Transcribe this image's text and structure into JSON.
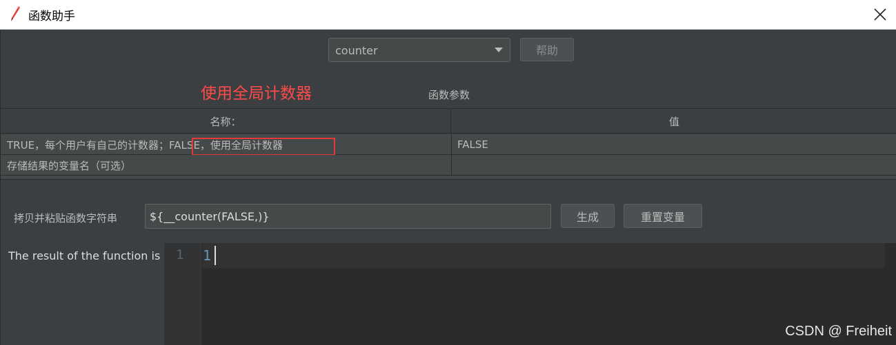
{
  "window": {
    "title": "函数助手"
  },
  "function_select": {
    "value": "counter"
  },
  "help_button": {
    "label": "帮助"
  },
  "annotation": {
    "text": "使用全局计数器"
  },
  "params_section": {
    "title": "函数参数"
  },
  "params_table": {
    "headers": {
      "name": "名称：",
      "value": "值"
    },
    "rows": [
      {
        "name_part1": "TRUE，每个用户有自己的计数器；",
        "name_part2": "FALSE，使用全局计数器",
        "value": "FALSE"
      },
      {
        "name": "存储结果的变量名（可选）",
        "value": ""
      }
    ]
  },
  "copy_row": {
    "label": "拷贝并粘贴函数字符串",
    "expression": "${__counter(FALSE,)}",
    "generate_label": "生成",
    "reset_label": "重置变量"
  },
  "result": {
    "label": "The result of the function is",
    "line_number": "1",
    "value": "1"
  },
  "watermark": "CSDN @ Freiheit",
  "colors": {
    "annotation": "#ff4a4a",
    "highlight_box": "#e53935",
    "result_number": "#6897bb"
  }
}
